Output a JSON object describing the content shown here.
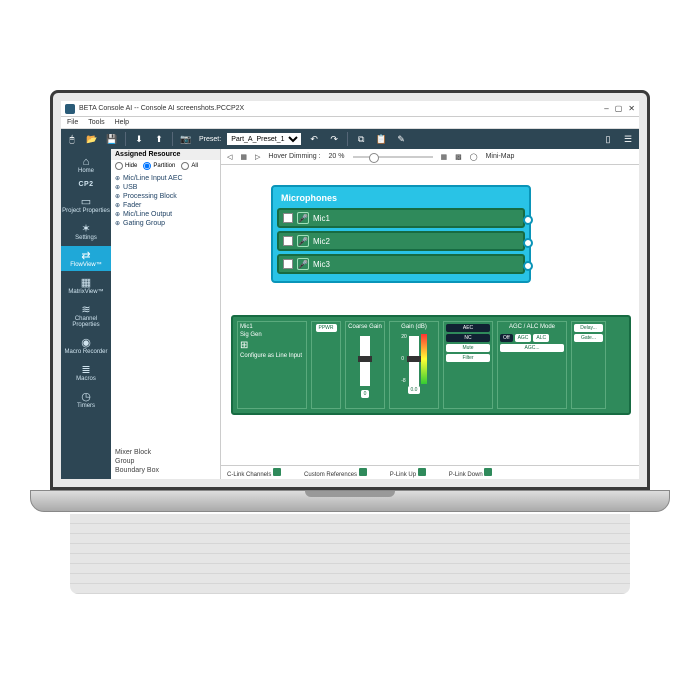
{
  "window": {
    "title": "BETA Console AI -- Console AI screenshots.PCCP2X"
  },
  "menubar": [
    "File",
    "Tools",
    "Help"
  ],
  "toolbar": {
    "preset_label": "Preset:",
    "preset_value": "Part_A_Preset_1"
  },
  "sidebar": {
    "brand": "CP2",
    "items": [
      {
        "icon": "⌂",
        "label": "Home"
      },
      {
        "icon": "▭",
        "label": "Project Properties"
      },
      {
        "icon": "✶",
        "label": "Settings"
      },
      {
        "icon": "⇄",
        "label": "FlowView™",
        "active": true
      },
      {
        "icon": "▦",
        "label": "MatrixView™"
      },
      {
        "icon": "≋",
        "label": "Channel Properties"
      },
      {
        "icon": "◉",
        "label": "Macro Recorder"
      },
      {
        "icon": "≣",
        "label": "Macros"
      },
      {
        "icon": "◷",
        "label": "Timers"
      }
    ]
  },
  "resources": {
    "header": "Assigned Resource",
    "filters": {
      "hide": "Hide",
      "partition": "Partition",
      "all": "All"
    },
    "items": [
      "Mic/Line Input AEC",
      "USB",
      "Processing Block",
      "Fader",
      "Mic/Line Output",
      "Gating Group"
    ],
    "bottom": [
      "Mixer Block",
      "Group",
      "Boundary Box"
    ]
  },
  "canvas_toolbar": {
    "hover_dimming_label": "Hover Dimming :",
    "hover_dimming_value": "20 %",
    "minimap_label": "Mini-Map"
  },
  "mic_block": {
    "title": "Microphones",
    "rows": [
      "Mic1",
      "Mic2",
      "Mic3"
    ]
  },
  "processing": {
    "channel_label": "Mic1",
    "siggen_label": "Sig Gen",
    "configure_label": "Configure as Line Input",
    "ppwr_label": "PPWR",
    "coarse_gain_label": "Coarse Gain",
    "coarse_gain_value": "0",
    "gain_label": "Gain (dB)",
    "gain_scale_top": "20",
    "gain_scale_mid": "0",
    "gain_scale_bot": "-8",
    "gain_value": "0.0",
    "buttons": {
      "aec": "AEC",
      "nc": "NC",
      "mute": "Mute",
      "filter": "Filter"
    },
    "alc_label": "AGC / ALC Mode",
    "alc_off": "Off",
    "alc_agc": "AGC",
    "alc_alc": "ALC",
    "agc_btn": "AGC...",
    "delay_label": "Delay...",
    "gate_label": "Gate..."
  },
  "statusbar": {
    "clink": "C-Link Channels",
    "custom": "Custom References",
    "plink_up": "P-Link Up",
    "plink_down": "P-Link Down"
  }
}
